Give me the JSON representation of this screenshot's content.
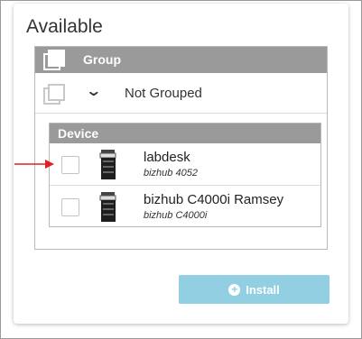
{
  "panel": {
    "title": "Available"
  },
  "group_table": {
    "header_label": "Group",
    "rows": [
      {
        "label": "Not Grouped",
        "expanded": true
      }
    ]
  },
  "device_table": {
    "header_label": "Device",
    "devices": [
      {
        "name": "labdesk",
        "model": "bizhub 4052",
        "checked": false,
        "icon": "printer-icon"
      },
      {
        "name": "bizhub C4000i Ramsey",
        "model": "bizhub C4000i",
        "checked": false,
        "icon": "printer-icon"
      }
    ]
  },
  "install_button": {
    "label": "Install",
    "icon": "plus-circle-icon",
    "enabled": false
  },
  "annotation": {
    "arrow_color": "#e02020",
    "icon": "red-arrow-icon"
  },
  "colors": {
    "header_bg": "#9a9a9a",
    "button_bg": "#93cfe2",
    "border": "#b8b8b8"
  }
}
